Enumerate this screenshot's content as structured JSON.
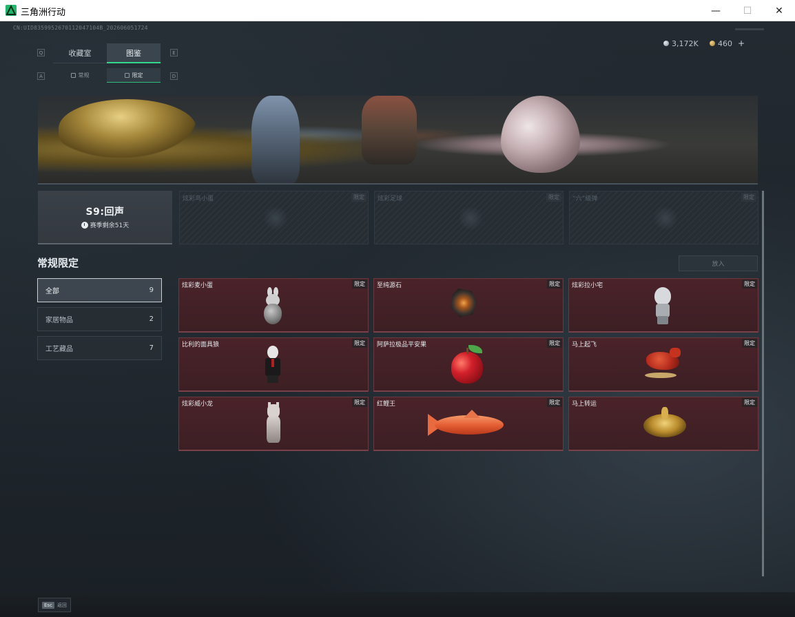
{
  "window": {
    "title": "三角洲行动",
    "minimize_glyph": "—",
    "maximize_glyph": "☐",
    "close_glyph": "✕"
  },
  "header": {
    "uid": "CN:UID8359952670112047104B_202606051724",
    "currency": [
      {
        "icon": "silver-coin-icon",
        "value": "3,172K",
        "color": "#c7ced3"
      },
      {
        "icon": "gold-coin-icon",
        "value": "460",
        "color": "#d9b25a",
        "plus": "+"
      }
    ]
  },
  "tabs": {
    "main": [
      {
        "label": "收藏室",
        "key": "Q",
        "active": false
      },
      {
        "label": "图鉴",
        "key": "E",
        "active": true
      }
    ],
    "sub": [
      {
        "label": "常规",
        "key": "A",
        "active": false
      },
      {
        "label": "限定",
        "key": "D",
        "active": true
      }
    ]
  },
  "season": {
    "title": "S9:回声",
    "remaining": "赛季剩余51天"
  },
  "locked_items": [
    {
      "name": "炫彩鸟小蛋",
      "tag": "限定"
    },
    {
      "name": "炫彩足球",
      "tag": "限定"
    },
    {
      "name": "“六”级弹",
      "tag": "限定"
    }
  ],
  "section": {
    "title": "常规限定",
    "action_label": "放入"
  },
  "categories": [
    {
      "label": "全部",
      "count": "9",
      "active": true
    },
    {
      "label": "家居物品",
      "count": "2",
      "active": false
    },
    {
      "label": "工艺藏品",
      "count": "7",
      "active": false
    }
  ],
  "items": [
    {
      "name": "炫彩麦小蛋",
      "tag": "限定",
      "art": "bunny-figure"
    },
    {
      "name": "至纯源石",
      "tag": "限定",
      "art": "glowing-stone"
    },
    {
      "name": "炫彩拉小宅",
      "tag": "限定",
      "art": "ghost-figure"
    },
    {
      "name": "比利的面具狼",
      "tag": "限定",
      "art": "puppet-figure"
    },
    {
      "name": "阿萨拉极品平安果",
      "tag": "限定",
      "art": "red-apple"
    },
    {
      "name": "马上起飞",
      "tag": "限定",
      "art": "red-horse"
    },
    {
      "name": "炫彩威小龙",
      "tag": "限定",
      "art": "stone-bust"
    },
    {
      "name": "红鲤王",
      "tag": "限定",
      "art": "red-carp"
    },
    {
      "name": "马上转运",
      "tag": "限定",
      "art": "gold-coin"
    }
  ],
  "footer": {
    "esc_key": "Esc",
    "back_label": "返回"
  },
  "colors": {
    "accent": "#32d98a",
    "item_bg": "#4a2329",
    "locked_bg": "#262d33"
  }
}
